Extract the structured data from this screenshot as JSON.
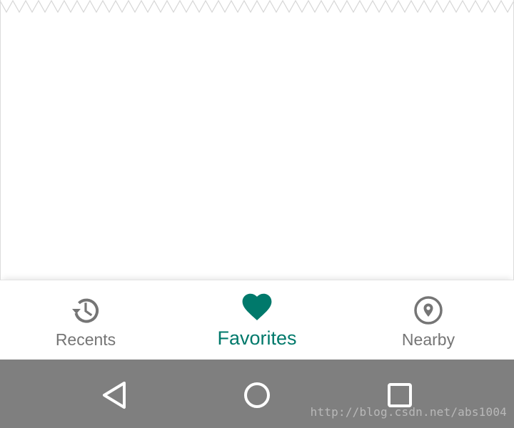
{
  "theme": {
    "accent": "#00796b",
    "inactive": "#757575",
    "system_bar": "#7f7f7f"
  },
  "bottom_nav": {
    "active_index": 1,
    "items": [
      {
        "label": "Recents",
        "icon": "history-icon",
        "active": false
      },
      {
        "label": "Favorites",
        "icon": "heart-icon",
        "active": true
      },
      {
        "label": "Nearby",
        "icon": "location-pin-icon",
        "active": false
      }
    ]
  },
  "system_nav": {
    "buttons": [
      "back-icon",
      "home-icon",
      "recents-square-icon"
    ]
  },
  "watermark": "http://blog.csdn.net/abs1004"
}
